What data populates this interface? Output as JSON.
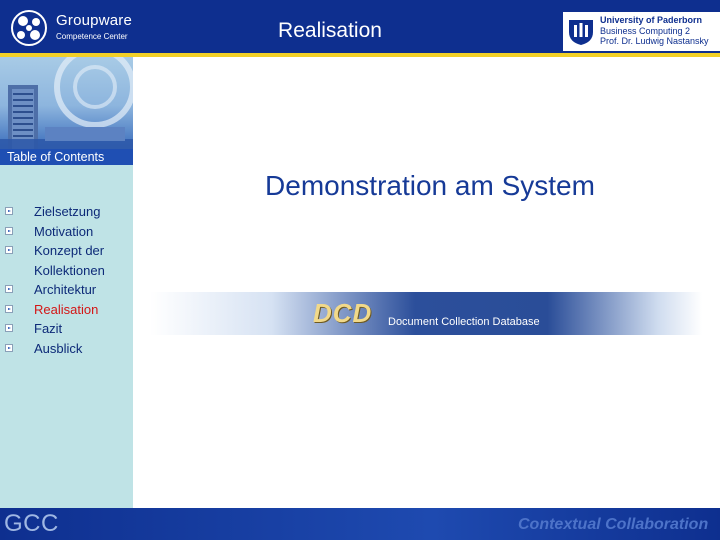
{
  "header": {
    "logo_name": "Groupware",
    "logo_sub": "Competence Center",
    "slide_title": "Realisation",
    "university": {
      "line1": "University of Paderborn",
      "line2": "Business Computing 2",
      "line3": "Prof. Dr. Ludwig Nastansky"
    }
  },
  "sidebar": {
    "toc_title": "Table of Contents",
    "items": [
      {
        "label": "Zielsetzung"
      },
      {
        "label": "Motivation"
      },
      {
        "label": "Konzept der Kollektionen"
      },
      {
        "label": "Architektur"
      },
      {
        "label": "Realisation"
      },
      {
        "label": "Fazit"
      },
      {
        "label": "Ausblick"
      }
    ],
    "active_item": "Realisation"
  },
  "main": {
    "heading": "Demonstration am System",
    "banner": {
      "logo": "DCD",
      "text": "Document Collection Database"
    }
  },
  "footer": {
    "brand": "GCC",
    "tagline": "Contextual Collaboration"
  },
  "colors": {
    "header_bg": "#0e2f8f",
    "header_rule": "#f2d027",
    "sidebar_bg": "#bfe3e6",
    "toc_text": "#0d2a78",
    "toc_active": "#d41616",
    "heading": "#163a97"
  }
}
